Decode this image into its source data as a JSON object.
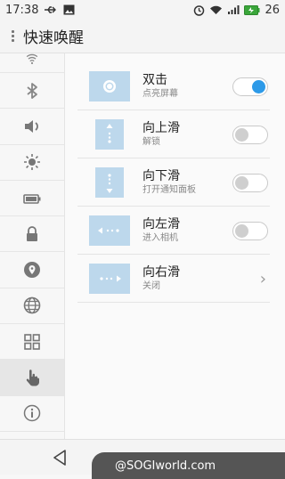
{
  "status_bar": {
    "time": "17:38",
    "battery": "26",
    "left_icons": [
      "usb-icon",
      "image-icon"
    ],
    "right_icons": [
      "alarm-icon",
      "wifi-icon",
      "signal-icon",
      "battery-icon"
    ]
  },
  "header": {
    "title": "快速唤醒"
  },
  "sidebar": {
    "items": [
      {
        "icon": "wifi-icon"
      },
      {
        "icon": "bluetooth-icon"
      },
      {
        "icon": "volume-icon"
      },
      {
        "icon": "brightness-icon"
      },
      {
        "icon": "battery-icon"
      },
      {
        "icon": "lock-icon"
      },
      {
        "icon": "location-icon"
      },
      {
        "icon": "globe-icon"
      },
      {
        "icon": "apps-grid-icon"
      },
      {
        "icon": "gesture-hand-icon",
        "active": true
      },
      {
        "icon": "info-icon"
      }
    ]
  },
  "gestures": [
    {
      "title": "双击",
      "subtitle": "点亮屏幕",
      "control": "toggle",
      "enabled": true
    },
    {
      "title": "向上滑",
      "subtitle": "解锁",
      "control": "toggle",
      "enabled": false
    },
    {
      "title": "向下滑",
      "subtitle": "打开通知面板",
      "control": "toggle",
      "enabled": false
    },
    {
      "title": "向左滑",
      "subtitle": "进入相机",
      "control": "toggle",
      "enabled": false
    },
    {
      "title": "向右滑",
      "subtitle": "关闭",
      "control": "chevron"
    }
  ],
  "watermark": {
    "text": "@SOGIworld.com"
  },
  "colors": {
    "accent": "#2d9ae8",
    "thumb": "#bdd8ec"
  }
}
